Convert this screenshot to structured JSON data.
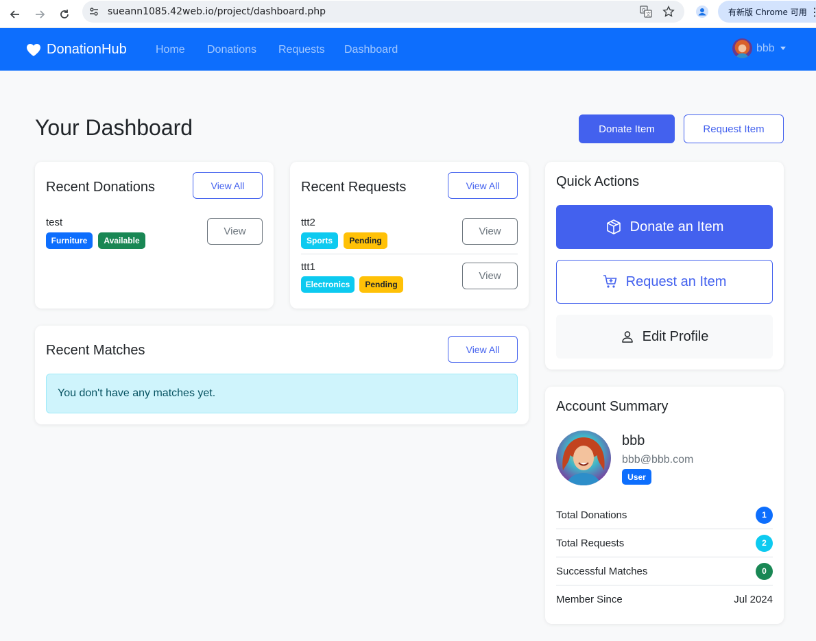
{
  "browser": {
    "url": "sueann1085.42web.io/project/dashboard.php",
    "update_label": "有新版 Chrome 可用"
  },
  "navbar": {
    "brand": "DonationHub",
    "links": [
      "Home",
      "Donations",
      "Requests",
      "Dashboard"
    ],
    "user_name": "bbb"
  },
  "header": {
    "title": "Your Dashboard",
    "donate_button": "Donate Item",
    "request_button": "Request Item"
  },
  "recent_donations": {
    "title": "Recent Donations",
    "view_all": "View All",
    "items": [
      {
        "name": "test",
        "category": "Furniture",
        "status": "Available",
        "action": "View"
      }
    ]
  },
  "recent_requests": {
    "title": "Recent Requests",
    "view_all": "View All",
    "items": [
      {
        "name": "ttt2",
        "category": "Sports",
        "status": "Pending",
        "action": "View"
      },
      {
        "name": "ttt1",
        "category": "Electronics",
        "status": "Pending",
        "action": "View"
      }
    ]
  },
  "recent_matches": {
    "title": "Recent Matches",
    "view_all": "View All",
    "empty_message": "You don't have any matches yet."
  },
  "quick_actions": {
    "title": "Quick Actions",
    "donate": "Donate an Item",
    "request": "Request an Item",
    "edit_profile": "Edit Profile"
  },
  "account_summary": {
    "title": "Account Summary",
    "name": "bbb",
    "email": "bbb@bbb.com",
    "role": "User",
    "stats": [
      {
        "label": "Total Donations",
        "value": "1",
        "color": "#0d6efd"
      },
      {
        "label": "Total Requests",
        "value": "2",
        "color": "#0dcaf0"
      },
      {
        "label": "Successful Matches",
        "value": "0",
        "color": "#198754"
      }
    ],
    "member_since_label": "Member Since",
    "member_since_value": "Jul 2024"
  },
  "colors": {
    "navbar": "#0d6efd",
    "accent": "#4361ee",
    "info_alert_bg": "#cff4fc"
  }
}
